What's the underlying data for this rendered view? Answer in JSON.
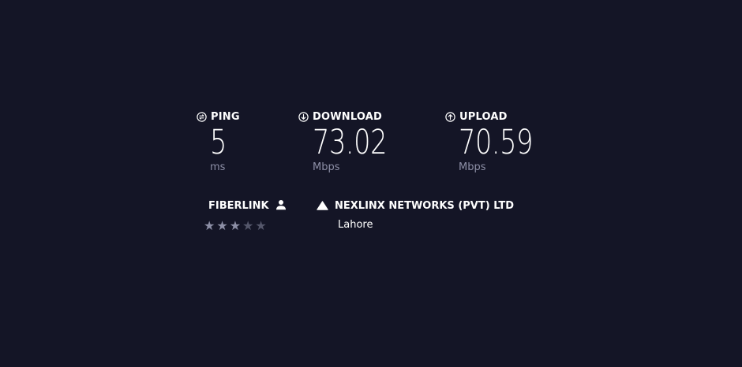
{
  "metrics": {
    "ping": {
      "label": "PING",
      "value": "5",
      "unit": "ms",
      "icon": "ping-icon"
    },
    "download": {
      "label": "DOWNLOAD",
      "value": "73.02",
      "unit": "Mbps",
      "icon": "download-arrow-icon"
    },
    "upload": {
      "label": "UPLOAD",
      "value": "70.59",
      "unit": "Mbps",
      "icon": "upload-arrow-icon"
    }
  },
  "isp": {
    "name": "FIBERLINK",
    "icon": "user-icon",
    "rating": 3,
    "rating_max": 5
  },
  "server": {
    "name": "NEXLINX NETWORKS (PVT) LTD",
    "location": "Lahore",
    "icon": "server-triangle-icon"
  },
  "colors": {
    "background": "#141526",
    "text": "#ffffff",
    "muted": "#8d8fa6",
    "star_off": "#55576b"
  }
}
